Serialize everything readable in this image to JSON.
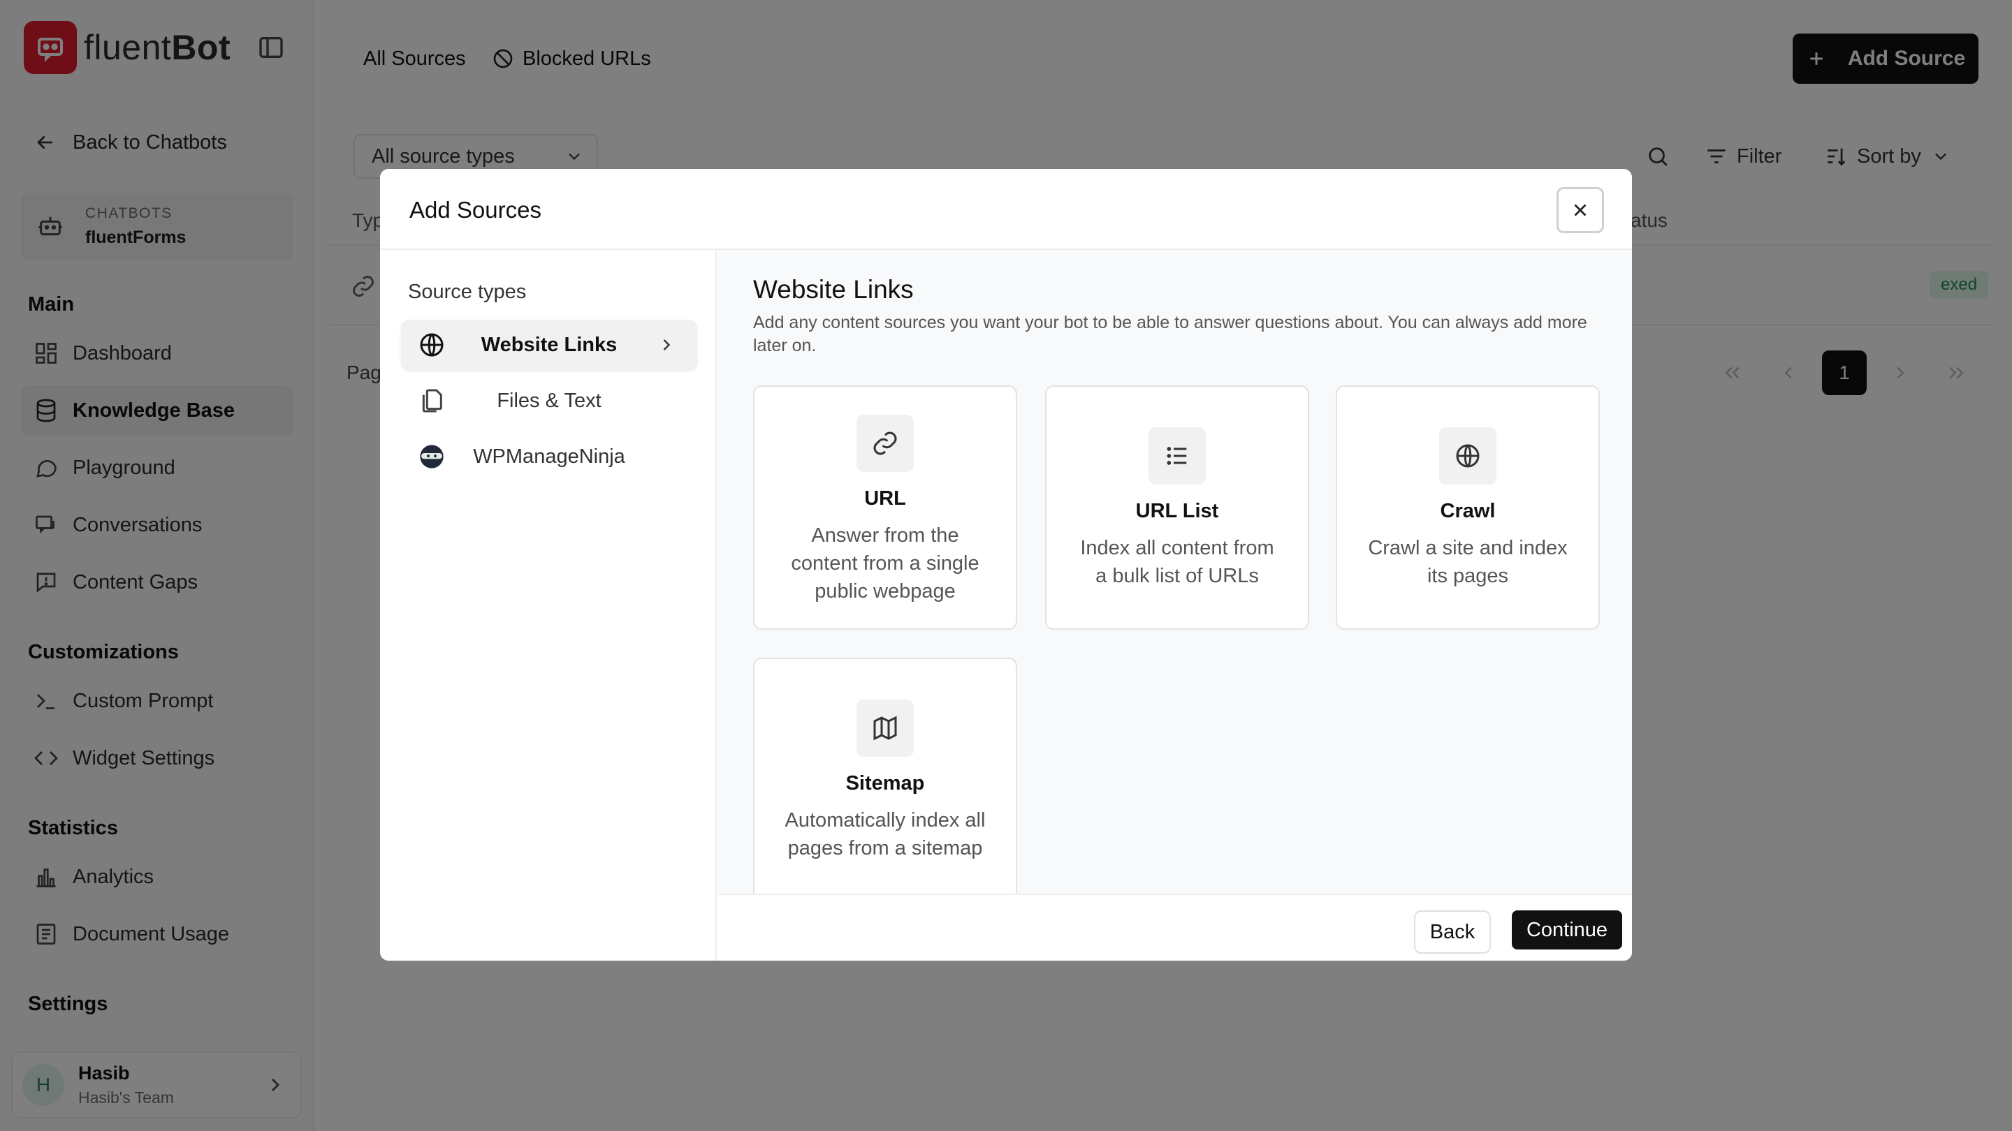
{
  "brand": {
    "name_light": "fluent",
    "name_bold": "Bot",
    "accent": "#e11d2e"
  },
  "sidebar": {
    "back_label": "Back to Chatbots",
    "chatbot": {
      "caption": "CHATBOTS",
      "name": "fluentForms"
    },
    "sections": [
      {
        "title": "Main",
        "items": [
          {
            "label": "Dashboard",
            "icon": "dashboard-icon"
          },
          {
            "label": "Knowledge Base",
            "icon": "database-icon",
            "active": true
          },
          {
            "label": "Playground",
            "icon": "chat-bubble-icon"
          },
          {
            "label": "Conversations",
            "icon": "messages-icon"
          },
          {
            "label": "Content Gaps",
            "icon": "message-alert-icon"
          }
        ]
      },
      {
        "title": "Customizations",
        "items": [
          {
            "label": "Custom Prompt",
            "icon": "terminal-icon"
          },
          {
            "label": "Widget Settings",
            "icon": "code-icon"
          }
        ]
      },
      {
        "title": "Statistics",
        "items": [
          {
            "label": "Analytics",
            "icon": "bar-chart-icon"
          },
          {
            "label": "Document Usage",
            "icon": "document-icon"
          }
        ]
      },
      {
        "title": "Settings",
        "items": []
      }
    ],
    "user": {
      "initial": "H",
      "name": "Hasib",
      "team": "Hasib's Team"
    }
  },
  "topbar": {
    "tabs": [
      "All Sources",
      "Blocked URLs"
    ],
    "add_source_label": "Add Source",
    "type_filter": "All source types",
    "filter_label": "Filter",
    "sort_label": "Sort by"
  },
  "table": {
    "header_type": "Typ",
    "header_status": "atus",
    "status_badge": "exed",
    "pager_text": "Pag",
    "current_page": "1"
  },
  "modal": {
    "title": "Add Sources",
    "source_types_label": "Source types",
    "source_types": [
      {
        "label": "Website Links",
        "icon": "globe-icon",
        "active": true
      },
      {
        "label": "Files & Text",
        "icon": "files-icon"
      },
      {
        "label": "WPManageNinja",
        "icon": "ninja-icon"
      }
    ],
    "pane": {
      "title": "Website Links",
      "description": "Add any content sources you want your bot to be able to answer questions about. You can always add more later on.",
      "cards": [
        {
          "title": "URL",
          "description": "Answer from the content from a single public webpage",
          "icon": "link-icon"
        },
        {
          "title": "URL List",
          "description": "Index all content from a bulk list of URLs",
          "icon": "list-icon"
        },
        {
          "title": "Crawl",
          "description": "Crawl a site and index its pages",
          "icon": "globe-icon"
        },
        {
          "title": "Sitemap",
          "description": "Automatically index all pages from a sitemap",
          "icon": "map-icon"
        }
      ]
    },
    "back_label": "Back",
    "continue_label": "Continue"
  }
}
